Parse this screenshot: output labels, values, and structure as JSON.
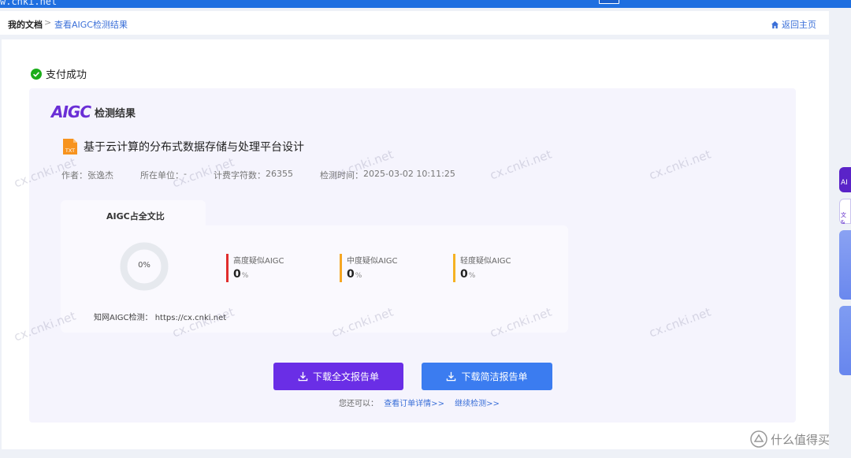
{
  "window": {
    "url": "w.cnki.net"
  },
  "breadcrumb": {
    "root": "我的文档",
    "separator": ">",
    "current": "查看AIGC检测结果"
  },
  "header": {
    "home_label": "返回主页"
  },
  "status": {
    "pay_success": "支付成功"
  },
  "result": {
    "logo_mark": "AIGC",
    "logo_title": "检测结果",
    "doc_badge": "TXT",
    "doc_title": "基于云计算的分布式数据存储与处理平台设计",
    "meta": {
      "author_label": "作者：",
      "author": "张逸杰",
      "unit_label": "所在单位：",
      "unit": "-",
      "chars_label": "计费字符数：",
      "chars": "26355",
      "time_label": "检测时间：",
      "time": "2025-03-02 10:11:25"
    },
    "ratio": {
      "tab_label": "AIGC占全文比",
      "overall": "0%",
      "overall_fraction": 0,
      "metrics": [
        {
          "name": "高度疑似AIGC",
          "value": "0",
          "unit": "%",
          "color": "#e02d2d"
        },
        {
          "name": "中度疑似AIGC",
          "value": "0",
          "unit": "%",
          "color": "#f5a623"
        },
        {
          "name": "轻度疑似AIGC",
          "value": "0",
          "unit": "%",
          "color": "#f5b223"
        }
      ],
      "site_label": "知网AIGC检测：",
      "site_url": "https://cx.cnki.net"
    },
    "buttons": {
      "download_full": "下载全文报告单",
      "download_brief": "下载简洁报告单"
    },
    "more": {
      "prefix": "您还可以：",
      "order_link": "查看订单详情>>",
      "continue_link": "继续检测>>"
    }
  },
  "watermark_text": "cx.cnki.net",
  "side_tools": {
    "a_label": "AI",
    "b_label": "文&"
  },
  "brand": {
    "text": "什么值得买"
  },
  "colors": {
    "accent_purple": "#6a2ee6",
    "accent_blue": "#3b7cf0",
    "link": "#3a6fd8",
    "success": "#1aad19"
  },
  "icons": [
    "home-icon",
    "check-circle-icon",
    "txt-file-icon",
    "download-icon",
    "brand-icon"
  ]
}
